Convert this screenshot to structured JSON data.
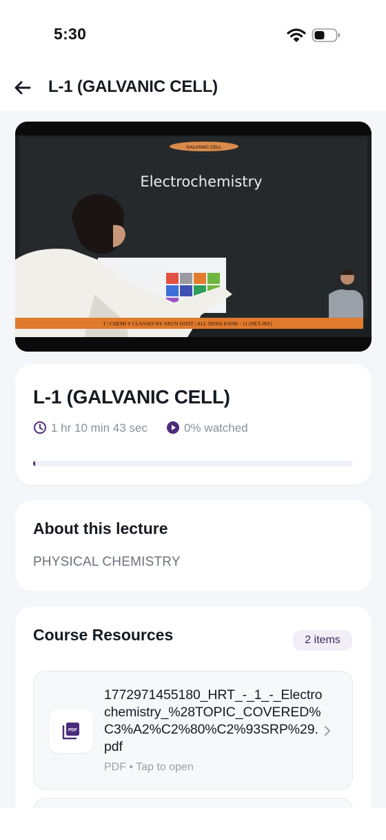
{
  "status_bar": {
    "time": "5:30"
  },
  "header": {
    "title": "L-1 (GALVANIC CELL)"
  },
  "video": {
    "banner": "GALVANIC CELL",
    "board_title": "Electrochemistry",
    "ticker": "T | CHEMI   Y CLASSES BY ARUN DIXIT | ALL INDIA RANK - 11 (NET-JRF)"
  },
  "lecture": {
    "title": "L-1 (GALVANIC CELL)",
    "duration": "1 hr 10 min 43 sec",
    "watched": "0% watched",
    "progress_fraction": 0.0
  },
  "about": {
    "heading": "About this lecture",
    "subject": "PHYSICAL CHEMISTRY"
  },
  "resources": {
    "heading": "Course Resources",
    "count_label": "2 items",
    "items": [
      {
        "name": "1772971455180_HRT_-_1_-_Electrochemistry_%28TOPIC_COVERED%C3%A2%C2%80%C2%93SRP%29.pdf",
        "meta": "PDF • Tap to open",
        "icon": "pdf-icon"
      }
    ]
  },
  "colors": {
    "accent": "#4b2c7a",
    "background": "#f5f6f9",
    "card": "#ffffff",
    "muted_text": "#8a8f99"
  }
}
